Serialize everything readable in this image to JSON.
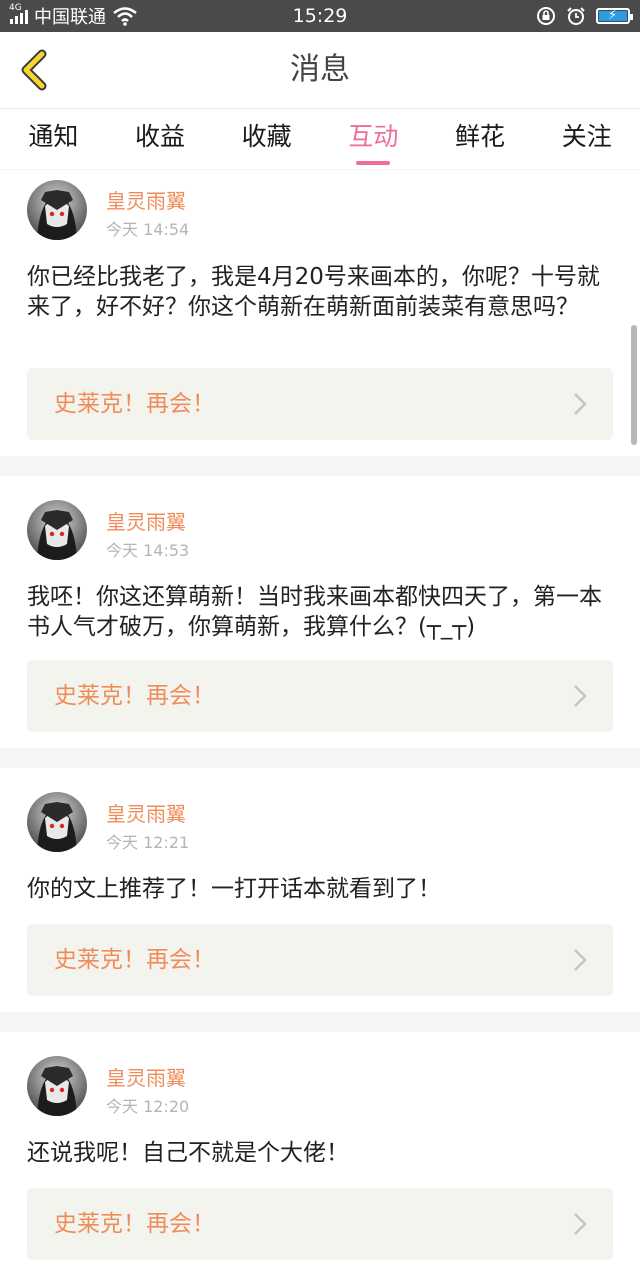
{
  "status_bar": {
    "network": "4G",
    "carrier": "中国联通",
    "time": "15:29",
    "battery_level": 1.0
  },
  "header": {
    "title": "消息",
    "back_icon": "chevron-left-icon"
  },
  "tabs": [
    {
      "label": "通知",
      "active": false
    },
    {
      "label": "收益",
      "active": false
    },
    {
      "label": "收藏",
      "active": false
    },
    {
      "label": "互动",
      "active": true
    },
    {
      "label": "鲜花",
      "active": false
    },
    {
      "label": "关注",
      "active": false
    }
  ],
  "messages": [
    {
      "username": "皇灵雨翼",
      "time": "今天 14:54",
      "content": "你已经比我老了，我是4月20号来画本的，你呢？十号就来了，好不好？你这个萌新在萌新面前装菜有意思吗？",
      "link": "史莱克！再会！"
    },
    {
      "username": "皇灵雨翼",
      "time": "今天 14:53",
      "content": "我呸！你这还算萌新！当时我来画本都快四天了，第一本书人气才破万，你算萌新，我算什么？(┬_┬)",
      "link": "史莱克！再会！"
    },
    {
      "username": "皇灵雨翼",
      "time": "今天 12:21",
      "content": "你的文上推荐了！一打开话本就看到了！",
      "link": "史莱克！再会！"
    },
    {
      "username": "皇灵雨翼",
      "time": "今天 12:20",
      "content": "还说我呢！自己不就是个大佬！",
      "link": "史莱克！再会！"
    }
  ],
  "colors": {
    "accent_pink": "#ef6c9e",
    "username_orange": "#f08c5a",
    "status_bar": "#4a4a4a",
    "link_box_bg": "#f4f4ee"
  }
}
